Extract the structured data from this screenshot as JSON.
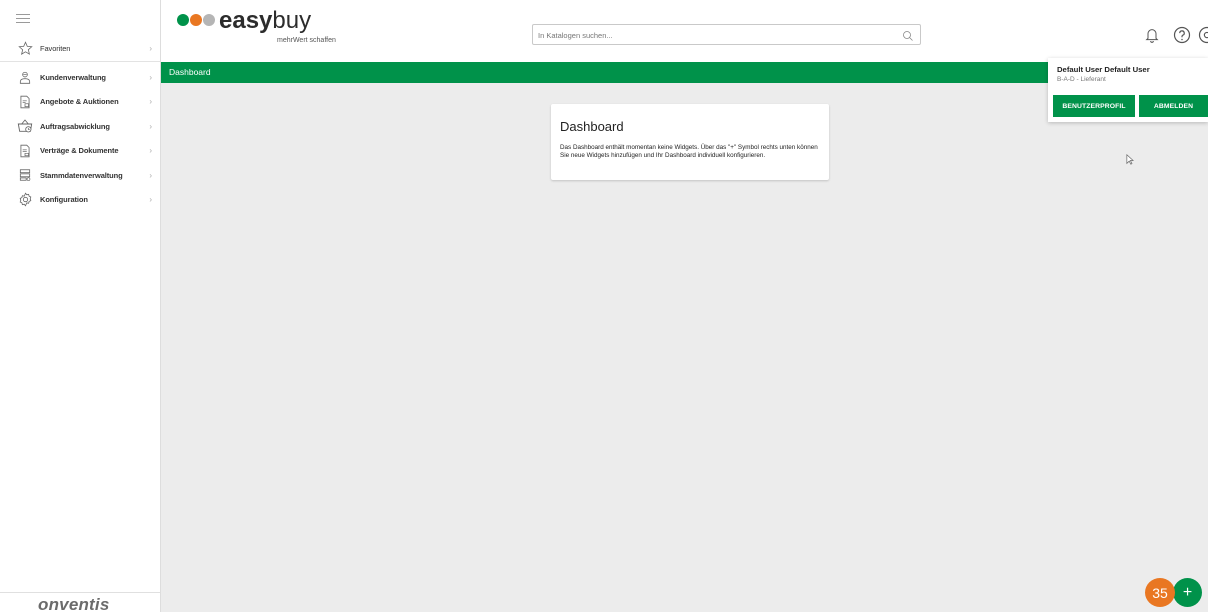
{
  "sidebar": {
    "items": [
      {
        "label": "Favoriten",
        "icon": "star-icon"
      },
      {
        "label": "Kundenverwaltung",
        "icon": "person-icon"
      },
      {
        "label": "Angebote & Auktionen",
        "icon": "document-list-icon"
      },
      {
        "label": "Auftragsabwicklung",
        "icon": "basket-clock-icon"
      },
      {
        "label": "Verträge & Dokumente",
        "icon": "document-icon"
      },
      {
        "label": "Stammdatenverwaltung",
        "icon": "database-icon"
      },
      {
        "label": "Konfiguration",
        "icon": "gear-icon"
      }
    ],
    "chevron": "›",
    "footer_brand": "onventis"
  },
  "header": {
    "logo_bold": "easy",
    "logo_light": "buy",
    "logo_tagline": "mehrWert schaffen",
    "logo_colors": [
      "#00924a",
      "#e97722",
      "#b5b5b5"
    ],
    "search_placeholder": "In Katalogen suchen..."
  },
  "greenbar": {
    "title": "Dashboard"
  },
  "dashboard_card": {
    "title": "Dashboard",
    "text": "Das Dashboard enthält momentan keine Widgets. Über das \"+\" Symbol rechts unten können Sie neue Widgets hinzufügen und Ihr Dashboard individuell konfigurieren."
  },
  "user_menu": {
    "name": "Default User Default User",
    "role": "B-A-D - Lieferant",
    "profile_button": "BENUTZERPROFIL",
    "logout_button": "ABMELDEN"
  },
  "fab": {
    "symbol": "+",
    "badge_count": "35"
  },
  "colors": {
    "accent": "#00924a",
    "badge": "#e97722"
  }
}
